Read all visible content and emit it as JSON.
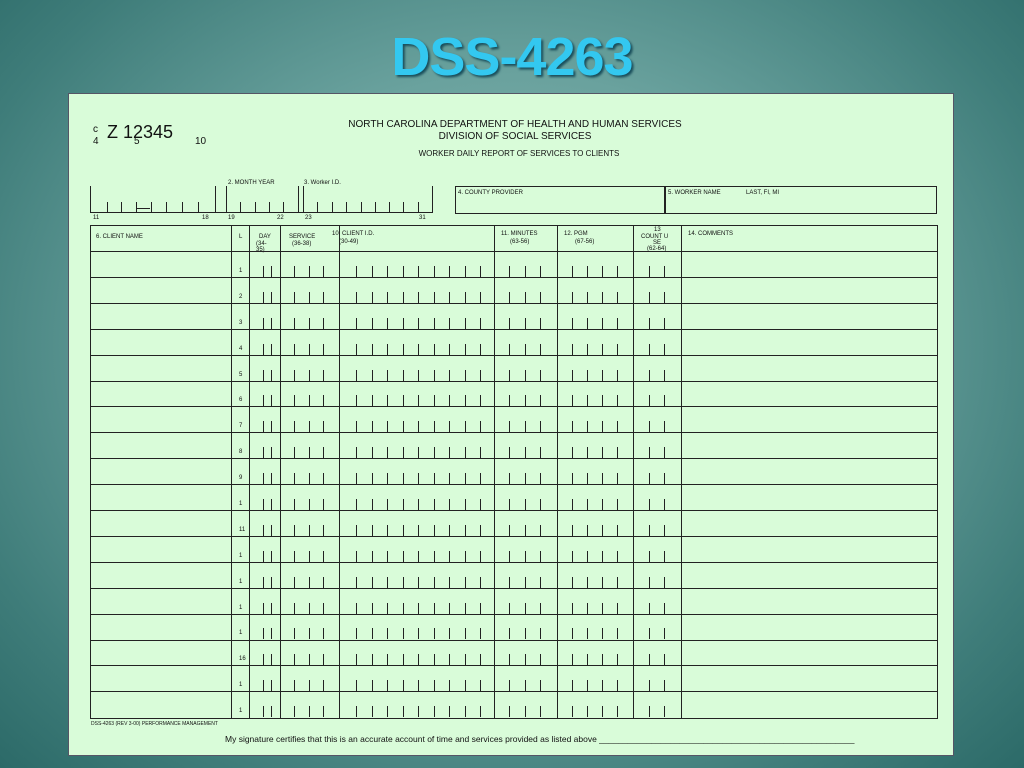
{
  "slide": {
    "title": "DSS-4263"
  },
  "form": {
    "code": {
      "c": "c",
      "four": "4",
      "main": "Z 12345",
      "five": "5",
      "ten": "10"
    },
    "header": {
      "line1": "NORTH CAROLINA DEPARTMENT OF HEALTH AND HUMAN SERVICES",
      "line2": "DIVISION OF SOCIAL SERVICES",
      "line3": "WORKER DAILY REPORT OF SERVICES TO CLIENTS"
    },
    "top_fields": {
      "month_year": "2. MONTH YEAR",
      "worker_id": "3. Worker I.D.",
      "ticks": [
        "11",
        "18",
        "19",
        "22",
        "23",
        "31"
      ],
      "county_provider": "4. COUNTY PROVIDER",
      "worker_name": "5. WORKER NAME",
      "last_fi_mi": "LAST, FI, MI"
    },
    "columns": {
      "client_name": "6. CLIENT NAME",
      "l": "L",
      "day": "DAY",
      "day_sub": "(34-",
      "day_sub2": "35)",
      "service": "SERVICE",
      "service_sub": "(36-38)",
      "client_id": "10. CLIENT I.D.",
      "client_id_sub": "(30-49)",
      "minutes": "11. MINUTES",
      "minutes_sub": "(63-56)",
      "pgm": "12. PGM",
      "pgm_sub": "(67-56)",
      "count_n": "13",
      "count_a": "COUNT U",
      "count_b": "SE",
      "count_c": "(62-64)",
      "comments": "14. COMMENTS"
    },
    "row_numbers": [
      "1",
      "2",
      "3",
      "4",
      "5",
      "6",
      "7",
      "8",
      "9",
      "1",
      "11",
      "1",
      "1",
      "1",
      "1",
      "16",
      "1",
      "1"
    ],
    "footer": {
      "form_id": "DSS-4263 (REV 3-00) PERFORMANCE MANAGEMENT",
      "signature": "My signature certifies that this is an accurate account of time and services provided as listed above ______________________________________________________"
    }
  }
}
